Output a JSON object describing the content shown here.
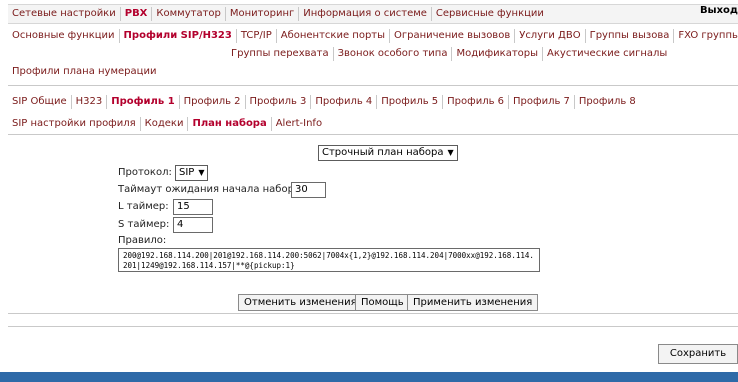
{
  "top_nav": {
    "items": [
      "Сетевые настройки",
      "PBX",
      "Коммутатор",
      "Мониторинг",
      "Информация о системе",
      "Сервисные функции"
    ],
    "active": "PBX",
    "exit_label": "Выход"
  },
  "pbx_nav": {
    "row1": [
      "Основные функции",
      "Профили SIP/H323",
      "TCP/IP",
      "Абонентские порты",
      "Ограничение вызовов",
      "Услуги ДВО",
      "Группы вызова",
      "FXO группы"
    ],
    "row2": [
      "Группы перехвата",
      "Звонок особого типа",
      "Модификаторы",
      "Акустические сигналы"
    ],
    "row3": [
      "Профили плана нумерации"
    ],
    "active": "Профили SIP/H323"
  },
  "profile_tabs": {
    "items": [
      "SIP Общие",
      "H323",
      "Профиль 1",
      "Профиль 2",
      "Профиль 3",
      "Профиль 4",
      "Профиль 5",
      "Профиль 6",
      "Профиль 7",
      "Профиль 8"
    ],
    "active": "Профиль 1"
  },
  "sub_tabs": {
    "items": [
      "SIP настройки профиля",
      "Кодеки",
      "План набора",
      "Alert-Info"
    ],
    "active": "План набора"
  },
  "form": {
    "plan_type": "Строчный план набора",
    "protocol_label": "Протокол:",
    "protocol_value": "SIP",
    "dial_timeout_label": "Таймаут ожидания начала набора:",
    "dial_timeout_value": "30",
    "l_timer_label": "L таймер:",
    "l_timer_value": "15",
    "s_timer_label": "S таймер:",
    "s_timer_value": "4",
    "rule_label": "Правило:",
    "rule_value": "200@192.168.114.200|201@192.168.114.200:5062|7004x{1,2}@192.168.114.204|7000xx@192.168.114.201|1249@192.168.114.157|**@{pickup:1}"
  },
  "buttons": {
    "cancel": "Отменить изменения",
    "help": "Помощь",
    "apply": "Применить изменения",
    "save": "Сохранить"
  },
  "colors": {
    "link": "#7a1a1a",
    "active": "#b3002d",
    "bottom_bar": "#2e6aa8"
  }
}
